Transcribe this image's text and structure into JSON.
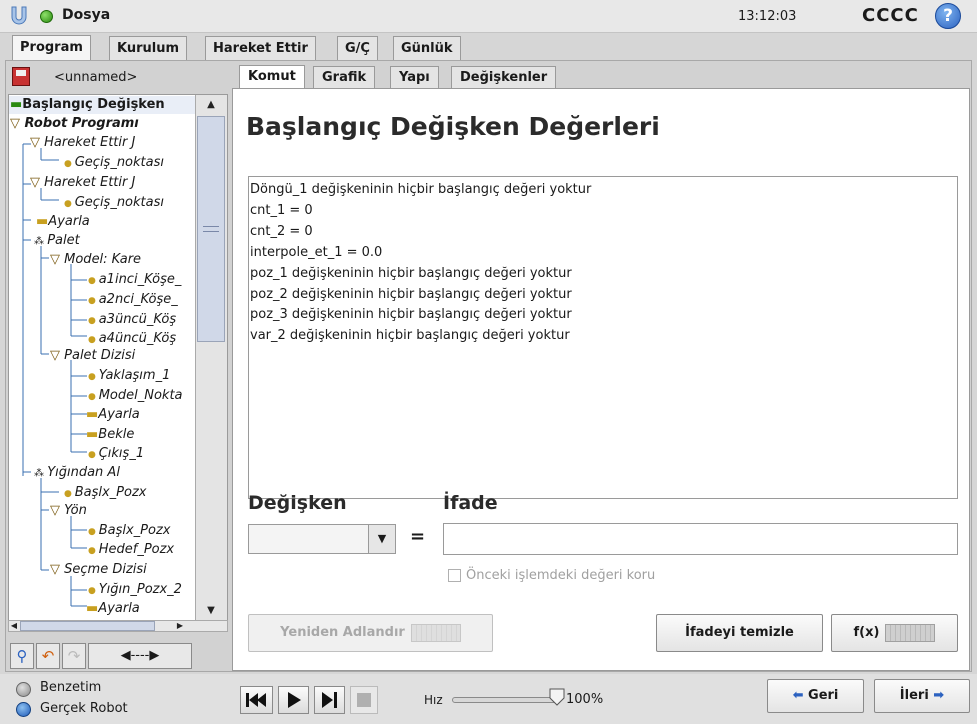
{
  "app": {
    "menu": "Dosya",
    "clock": "13:12:03",
    "robot_name": "CCCC",
    "help": "?"
  },
  "main_tabs": [
    "Program",
    "Kurulum",
    "Hareket Ettir",
    "G/Ç",
    "Günlük"
  ],
  "left": {
    "program_name": "<unnamed>",
    "tree": [
      {
        "label": "Başlangıç Değişken",
        "bold": true,
        "italic": false
      },
      {
        "label": "Robot Programı",
        "bold": true
      },
      {
        "label": "Hareket Ettir J"
      },
      {
        "label": "Geçiş_noktası"
      },
      {
        "label": "Hareket Ettir J"
      },
      {
        "label": "Geçiş_noktası"
      },
      {
        "label": "Ayarla"
      },
      {
        "label": "Palet"
      },
      {
        "label": "Model: Kare"
      },
      {
        "label": "a1inci_Köşe_"
      },
      {
        "label": "a2nci_Köşe_"
      },
      {
        "label": "a3üncü_Köş"
      },
      {
        "label": "a4üncü_Köş"
      },
      {
        "label": "Palet Dizisi"
      },
      {
        "label": "Yaklaşım_1"
      },
      {
        "label": "Model_Nokta"
      },
      {
        "label": "Ayarla"
      },
      {
        "label": "Bekle"
      },
      {
        "label": "Çıkış_1"
      },
      {
        "label": "Yığından Al"
      },
      {
        "label": "Başlx_Pozx"
      },
      {
        "label": "Yön"
      },
      {
        "label": "Başlx_Pozx"
      },
      {
        "label": "Hedef_Pozx"
      },
      {
        "label": "Seçme Dizisi"
      },
      {
        "label": "Yığın_Pozx_2"
      },
      {
        "label": "Ayarla"
      }
    ]
  },
  "content_tabs": [
    "Komut",
    "Grafik",
    "Yapı",
    "Değişkenler"
  ],
  "content": {
    "title": "Başlangıç Değişken Değerleri",
    "values": [
      "Döngü_1 değişkeninin hiçbir başlangıç değeri yoktur",
      "cnt_1 = 0",
      "cnt_2 = 0",
      "interpole_et_1 = 0.0",
      "poz_1 değişkeninin hiçbir başlangıç değeri yoktur",
      "poz_2 değişkeninin hiçbir başlangıç değeri yoktur",
      "poz_3 değişkeninin hiçbir başlangıç değeri yoktur",
      "var_2 değişkeninin hiçbir başlangıç değeri yoktur"
    ],
    "variable_label": "Değişken",
    "expression_label": "İfade",
    "equals": "=",
    "variable_value": "",
    "expression_value": "",
    "keep_label": "Önceki işlemdeki değeri koru",
    "rename_button": "Yeniden Adlandır",
    "clear_button": "İfadeyi temizle",
    "fx_button": "f(x)"
  },
  "bottom": {
    "simulation": "Benzetim",
    "real_robot": "Gerçek Robot",
    "speed_label": "Hız",
    "speed_value": "100%",
    "speed_fraction": 1.0,
    "back": "Geri",
    "next": "İleri"
  },
  "colors": {
    "accent_blue": "#2c62c0",
    "status_green": "#2a8a10"
  }
}
